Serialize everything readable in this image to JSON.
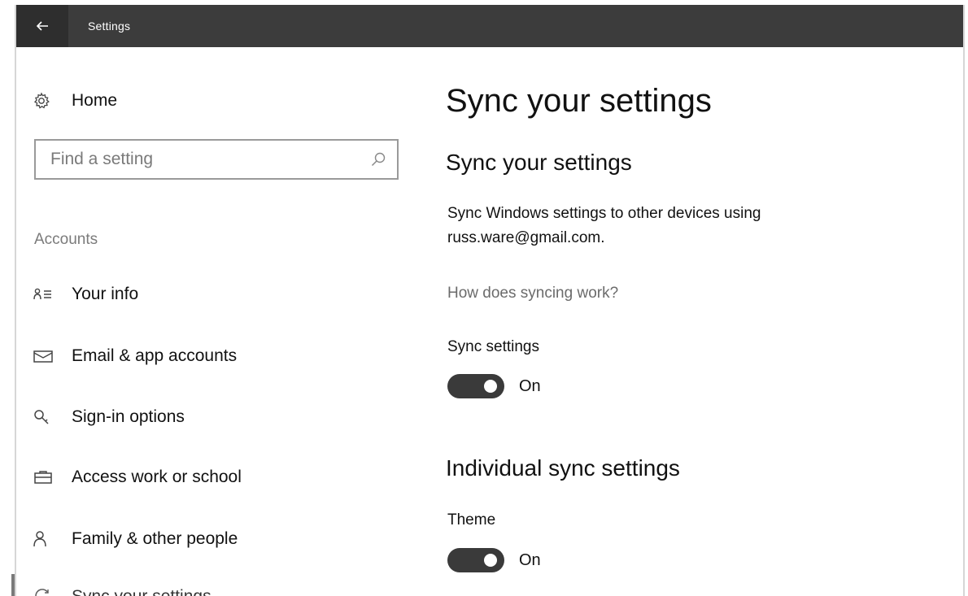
{
  "titlebar": {
    "title": "Settings",
    "back_icon": "back-arrow-icon"
  },
  "sidebar": {
    "home": {
      "label": "Home",
      "icon": "gear-icon"
    },
    "search": {
      "placeholder": "Find a setting",
      "icon": "search-icon"
    },
    "section": "Accounts",
    "items": [
      {
        "label": "Your info",
        "icon": "person-card-icon"
      },
      {
        "label": "Email & app accounts",
        "icon": "mail-icon"
      },
      {
        "label": "Sign-in options",
        "icon": "key-icon"
      },
      {
        "label": "Access work or school",
        "icon": "briefcase-icon"
      },
      {
        "label": "Family & other people",
        "icon": "person-icon"
      },
      {
        "label": "Sync your settings",
        "icon": "sync-icon"
      }
    ]
  },
  "main": {
    "title": "Sync your settings",
    "subtitle": "Sync your settings",
    "description": "Sync Windows settings to other devices using russ.ware@gmail.com.",
    "link": "How does syncing work?",
    "sync_settings": {
      "label": "Sync settings",
      "state": "On",
      "on": true
    },
    "individual_heading": "Individual sync settings",
    "theme": {
      "label": "Theme",
      "state": "On",
      "on": true
    }
  },
  "colors": {
    "titlebar": "#3c3c3c",
    "toggle_on": "#3a3a3a",
    "secondary_text": "#7b7b7b"
  }
}
